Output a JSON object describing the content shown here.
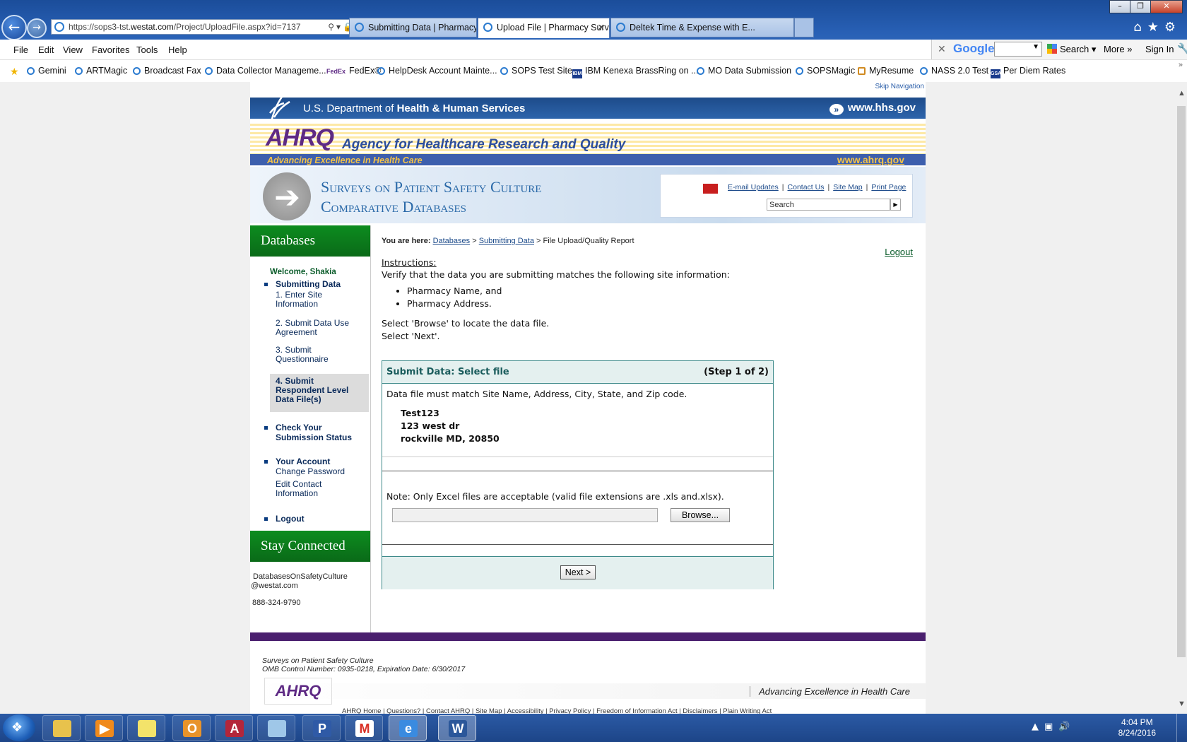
{
  "browser": {
    "url_prefix": "https://sops3-tst.",
    "url_host": "westat.com",
    "url_path": "/Project/UploadFile.aspx?id=7137",
    "tabs": [
      {
        "label": "Submitting Data | Pharmacy S..."
      },
      {
        "label": "Upload File | Pharmacy Surv..."
      },
      {
        "label": "Deltek Time & Expense with E..."
      }
    ],
    "menu": [
      "File",
      "Edit",
      "View",
      "Favorites",
      "Tools",
      "Help"
    ],
    "google": {
      "logo": "Google",
      "search": "Search",
      "more": "More",
      "more_arrows": "»",
      "signin": "Sign In"
    },
    "favorites": [
      "Gemini",
      "ARTMagic",
      "Broadcast Fax",
      "Data Collector Manageme...",
      "FedEx®",
      "HelpDesk Account Mainte...",
      "SOPS Test Site",
      "IBM Kenexa BrassRing on ...",
      "MO Data Submission",
      "SOPSMagic",
      "MyResume",
      "NASS 2.0 Test",
      "Per Diem Rates"
    ]
  },
  "site": {
    "skip_nav": "Skip Navigation",
    "hhs_prefix": "U.S. Department of ",
    "hhs_bold": "Health & Human Services",
    "hhs_url": "www.hhs.gov",
    "ahrq_logo": "AHRQ",
    "agency": "Agency for Healthcare Research and Quality",
    "tagline": "Advancing Excellence in Health Care",
    "ahrq_url": "www.ahrq.gov",
    "sops_line1": "Surveys on Patient Safety Culture",
    "sops_line2": "Comparative Databases",
    "util_links": [
      "E-mail Updates",
      "Contact Us",
      "Site Map",
      "Print Page"
    ],
    "search_placeholder": "Search"
  },
  "sidebar": {
    "databases_heading": "Databases",
    "welcome": "Welcome, Shakia",
    "submitting_data": "Submitting Data",
    "steps": [
      "1. Enter Site Information",
      "2. Submit Data Use Agreement",
      "3. Submit Questionnaire",
      "4. Submit Respondent Level Data File(s)"
    ],
    "check_status": "Check Your Submission Status",
    "your_account": "Your Account",
    "account_links": [
      "Change Password",
      "Edit Contact Information"
    ],
    "logout": "Logout",
    "stay_connected": "Stay Connected",
    "email_line1": "DatabasesOnSafetyCulture",
    "email_line2": "@westat.com",
    "phone": "888-324-9790"
  },
  "main": {
    "breadcrumb_label": "You are here:",
    "breadcrumb": [
      "Databases",
      "Submitting Data",
      "File Upload/Quality Report"
    ],
    "logout": "Logout",
    "instructions_title": "Instructions:",
    "instructions_text": "Verify that the data you are submitting matches the following site information:",
    "instructions_items": [
      "Pharmacy Name, and",
      "Pharmacy Address."
    ],
    "select_browse": "Select 'Browse' to locate the data file.",
    "select_next": "Select 'Next'.",
    "panel": {
      "title": "Submit Data: Select file",
      "step": "(Step 1 of 2)",
      "must_match": "Data file must match Site Name, Address, City, State, and Zip code.",
      "site_name": "Test123",
      "address": "123 west dr",
      "city_state_zip": "rockville MD, 20850",
      "note": "Note: Only Excel files are acceptable (valid file extensions are .xls and.xlsx).",
      "browse_label": "Browse...",
      "next_label": "Next >"
    }
  },
  "footer": {
    "line1": "Surveys on Patient Safety Culture",
    "line2": "OMB Control Number: 0935-0218, Expiration Date: 6/30/2017",
    "logo": "AHRQ",
    "tagline": "Advancing Excellence in Health Care",
    "links": "AHRQ Home | Questions? | Contact AHRQ | Site Map | Accessibility | Privacy Policy | Freedom of Information Act | Disclaimers | Plain Writing Act"
  },
  "taskbar": {
    "time": "4:04 PM",
    "date": "8/24/2016"
  }
}
